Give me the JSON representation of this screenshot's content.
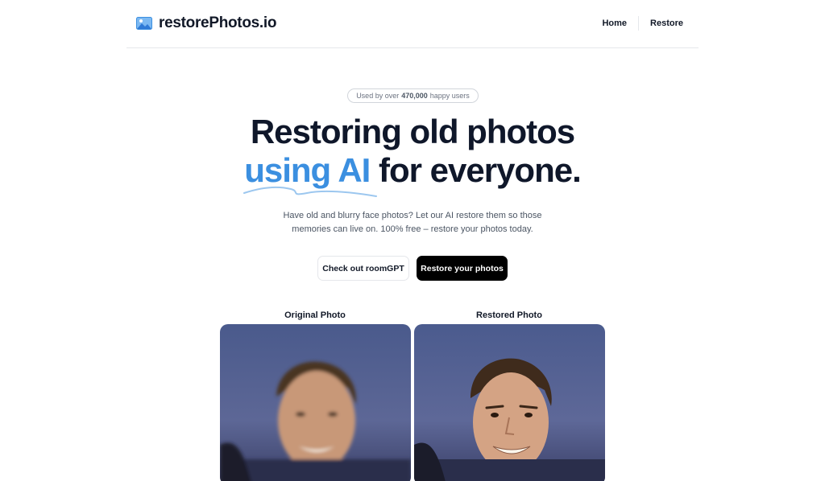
{
  "header": {
    "brand": "restorePhotos.io",
    "nav": [
      {
        "label": "Home"
      },
      {
        "label": "Restore"
      }
    ]
  },
  "hero": {
    "badge_prefix": "Used by over",
    "badge_count": "470,000",
    "badge_suffix": "happy users",
    "title_line1": "Restoring old photos",
    "title_accent": "using AI",
    "title_rest": "for everyone.",
    "subtitle": "Have old and blurry face photos? Let our AI restore them so those memories can live on. 100% free – restore your photos today.",
    "secondary_button": "Check out roomGPT",
    "primary_button": "Restore your photos"
  },
  "comparison": {
    "original_label": "Original Photo",
    "restored_label": "Restored Photo"
  },
  "colors": {
    "accent": "#3b8fe0",
    "text": "#0f172a",
    "primary_button": "#000000"
  }
}
